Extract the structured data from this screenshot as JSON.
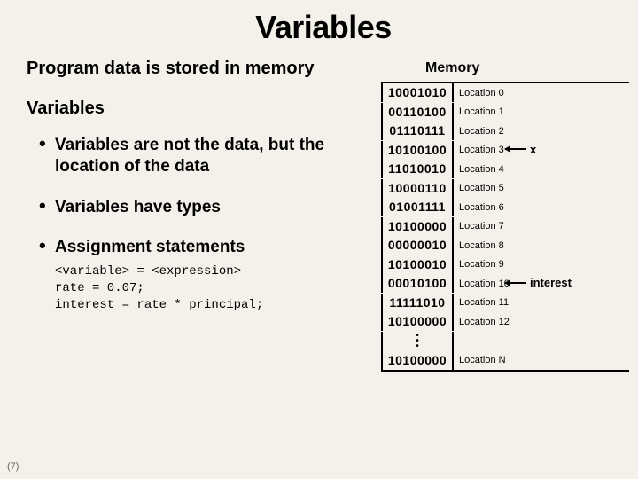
{
  "title": "Variables",
  "line1": "Program data is stored in memory",
  "line2": "Variables",
  "bullets": {
    "b1": "Variables are not the data, but the location of the data",
    "b2": "Variables have types",
    "b3": "Assignment statements"
  },
  "code": "<variable> = <expression>\nrate = 0.07;\ninterest = rate * principal;",
  "memory": {
    "header": "Memory",
    "rows": [
      {
        "bits": "10001010",
        "label": "Location 0"
      },
      {
        "bits": "00110100",
        "label": "Location 1"
      },
      {
        "bits": "01110111",
        "label": "Location 2"
      },
      {
        "bits": "10100100",
        "label": "Location 3"
      },
      {
        "bits": "11010010",
        "label": "Location 4"
      },
      {
        "bits": "10000110",
        "label": "Location 5"
      },
      {
        "bits": "01001111",
        "label": "Location 6"
      },
      {
        "bits": "10100000",
        "label": "Location 7"
      },
      {
        "bits": "00000010",
        "label": "Location 8"
      },
      {
        "bits": "10100010",
        "label": "Location 9"
      },
      {
        "bits": "00010100",
        "label": "Location 10"
      },
      {
        "bits": "11111010",
        "label": "Location 11"
      },
      {
        "bits": "10100000",
        "label": "Location 12"
      }
    ],
    "last": {
      "bits": "10100000",
      "label": "Location N"
    },
    "pointers": {
      "x": {
        "text": "x",
        "row": 3
      },
      "interest": {
        "text": "interest",
        "row": 10
      }
    }
  },
  "page": "(7)"
}
